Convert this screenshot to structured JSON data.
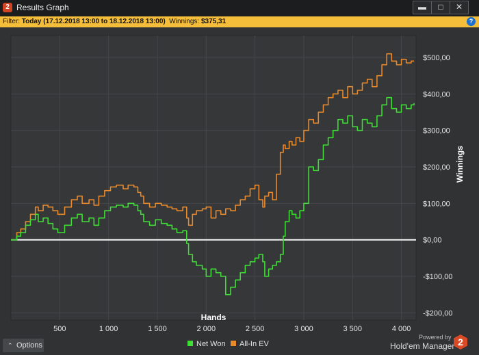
{
  "window": {
    "title": "Results Graph",
    "controls": {
      "minimize": "▬",
      "maximize": "□",
      "close": "✕"
    }
  },
  "filter": {
    "label": "Filter: ",
    "range": "Today (17.12.2018 13:00 to 18.12.2018 13:00)",
    "winnings_label": "  Winnings: ",
    "winnings_value": "$375,31",
    "help_icon": "?"
  },
  "chart_data": {
    "type": "line",
    "xlabel": "Hands",
    "ylabel": "Winnings",
    "xlim": [
      0,
      4150
    ],
    "ylim": [
      -220,
      560
    ],
    "x_ticks": [
      500,
      1000,
      1500,
      2000,
      2500,
      3000,
      3500,
      4000
    ],
    "x_tick_labels": [
      "500",
      "1 000",
      "1 500",
      "2 000",
      "2 500",
      "3 000",
      "3 500",
      "4 000"
    ],
    "y_ticks": [
      500,
      400,
      300,
      200,
      100,
      0,
      -100,
      -200
    ],
    "y_tick_labels": [
      "$500,00",
      "$400,00",
      "$300,00",
      "$200,00",
      "$100,00",
      "$0,00",
      "-$100,00",
      "-$200,00"
    ],
    "grid": true,
    "zero_line": true,
    "legend_position": "bottom-center",
    "series": [
      {
        "name": "Net Won",
        "color": "#3fdd35",
        "x": [
          0,
          60,
          100,
          150,
          200,
          250,
          280,
          330,
          380,
          430,
          480,
          550,
          620,
          680,
          730,
          800,
          850,
          900,
          960,
          1020,
          1080,
          1150,
          1200,
          1260,
          1300,
          1330,
          1360,
          1420,
          1480,
          1540,
          1600,
          1650,
          1700,
          1760,
          1800,
          1820,
          1860,
          1900,
          1960,
          2000,
          2050,
          2100,
          2150,
          2200,
          2250,
          2300,
          2350,
          2400,
          2450,
          2500,
          2540,
          2580,
          2600,
          2640,
          2680,
          2720,
          2760,
          2790,
          2810,
          2850,
          2880,
          2920,
          2960,
          3000,
          3050,
          3100,
          3150,
          3200,
          3250,
          3300,
          3350,
          3400,
          3450,
          3500,
          3550,
          3600,
          3650,
          3700,
          3750,
          3800,
          3850,
          3900,
          3950,
          4000,
          4050,
          4100,
          4130
        ],
        "values": [
          0,
          10,
          20,
          40,
          55,
          70,
          50,
          60,
          45,
          30,
          20,
          40,
          60,
          70,
          50,
          60,
          40,
          60,
          80,
          90,
          95,
          90,
          100,
          95,
          80,
          70,
          50,
          40,
          55,
          45,
          40,
          30,
          20,
          25,
          -10,
          -40,
          -60,
          -70,
          -80,
          -100,
          -80,
          -90,
          -100,
          -150,
          -130,
          -110,
          -90,
          -70,
          -60,
          -50,
          -40,
          -60,
          -100,
          -80,
          -70,
          -60,
          -40,
          10,
          50,
          80,
          70,
          60,
          80,
          100,
          200,
          190,
          220,
          260,
          280,
          300,
          330,
          320,
          340,
          310,
          300,
          330,
          320,
          310,
          340,
          370,
          390,
          360,
          350,
          370,
          360,
          370,
          375
        ]
      },
      {
        "name": "All-In EV",
        "color": "#e88a2c",
        "x": [
          0,
          60,
          100,
          150,
          200,
          250,
          280,
          330,
          380,
          430,
          480,
          550,
          620,
          680,
          730,
          800,
          850,
          900,
          960,
          1020,
          1080,
          1150,
          1200,
          1260,
          1300,
          1330,
          1360,
          1420,
          1480,
          1540,
          1600,
          1650,
          1700,
          1760,
          1800,
          1820,
          1860,
          1900,
          1960,
          2000,
          2050,
          2100,
          2150,
          2200,
          2250,
          2300,
          2350,
          2400,
          2450,
          2500,
          2540,
          2580,
          2600,
          2640,
          2680,
          2720,
          2760,
          2790,
          2810,
          2850,
          2880,
          2920,
          2960,
          3000,
          3050,
          3100,
          3150,
          3200,
          3250,
          3300,
          3350,
          3400,
          3450,
          3500,
          3550,
          3600,
          3650,
          3700,
          3750,
          3800,
          3850,
          3900,
          3950,
          4000,
          4050,
          4100,
          4130
        ],
        "values": [
          0,
          20,
          30,
          50,
          70,
          90,
          80,
          95,
          90,
          80,
          70,
          90,
          110,
          120,
          100,
          110,
          95,
          120,
          135,
          145,
          150,
          140,
          150,
          145,
          130,
          120,
          100,
          90,
          100,
          95,
          90,
          85,
          80,
          90,
          60,
          40,
          70,
          80,
          85,
          90,
          60,
          80,
          70,
          85,
          80,
          95,
          110,
          120,
          140,
          150,
          110,
          90,
          120,
          130,
          110,
          180,
          240,
          260,
          250,
          270,
          260,
          280,
          270,
          300,
          330,
          320,
          350,
          370,
          390,
          400,
          410,
          390,
          420,
          400,
          410,
          430,
          440,
          420,
          450,
          480,
          510,
          490,
          480,
          495,
          485,
          490,
          490
        ]
      }
    ]
  },
  "footer": {
    "options_label": "Options",
    "options_chevron": "⌃",
    "legend": [
      {
        "label": "Net Won",
        "color": "#3fdd35"
      },
      {
        "label": "All-In EV",
        "color": "#e88a2c"
      }
    ],
    "powered_by": "Powered by",
    "brand": "Hold'em Manager",
    "brand_logo": "2"
  }
}
